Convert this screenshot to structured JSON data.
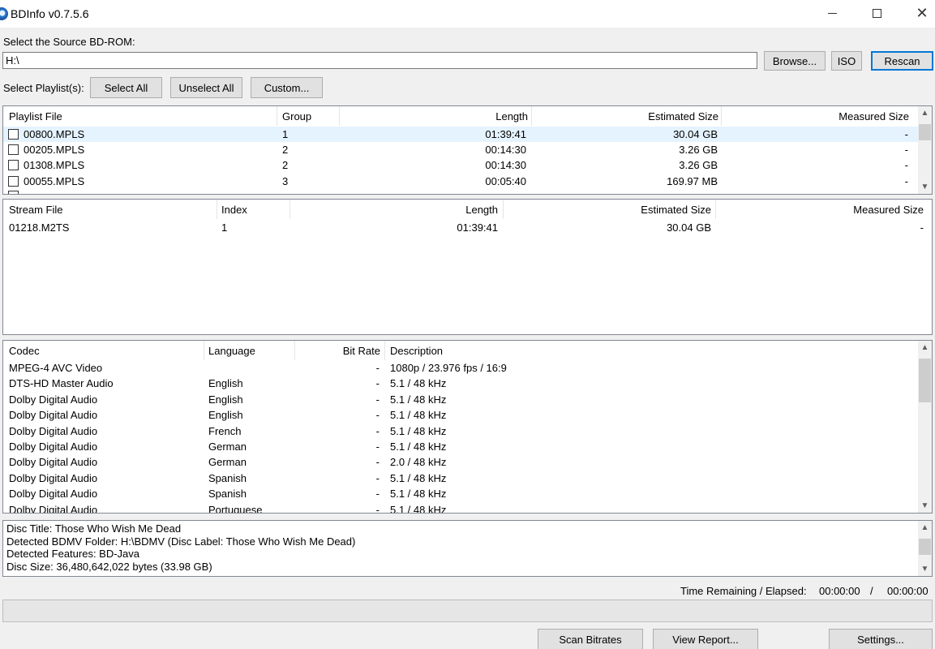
{
  "window": {
    "title": "BDInfo v0.7.5.6"
  },
  "source": {
    "label": "Select the Source BD-ROM:",
    "path": "H:\\",
    "browse_label": "Browse...",
    "iso_label": "ISO",
    "rescan_label": "Rescan"
  },
  "playlist_select": {
    "label": "Select Playlist(s):",
    "select_all": "Select All",
    "unselect_all": "Unselect All",
    "custom": "Custom..."
  },
  "playlists": {
    "columns": [
      "Playlist File",
      "Group",
      "Length",
      "Estimated Size",
      "Measured Size"
    ],
    "rows": [
      {
        "file": "00800.MPLS",
        "group": "1",
        "length": "01:39:41",
        "estimated": "30.04 GB",
        "measured": "-"
      },
      {
        "file": "00205.MPLS",
        "group": "2",
        "length": "00:14:30",
        "estimated": "3.26 GB",
        "measured": "-"
      },
      {
        "file": "01308.MPLS",
        "group": "2",
        "length": "00:14:30",
        "estimated": "3.26 GB",
        "measured": "-"
      },
      {
        "file": "00055.MPLS",
        "group": "3",
        "length": "00:05:40",
        "estimated": "169.97 MB",
        "measured": "-"
      }
    ]
  },
  "streams": {
    "columns": [
      "Stream File",
      "Index",
      "Length",
      "Estimated Size",
      "Measured Size"
    ],
    "rows": [
      {
        "file": "01218.M2TS",
        "index": "1",
        "length": "01:39:41",
        "estimated": "30.04 GB",
        "measured": "-"
      }
    ]
  },
  "codecs": {
    "columns": [
      "Codec",
      "Language",
      "Bit Rate",
      "Description"
    ],
    "rows": [
      {
        "codec": "MPEG-4 AVC Video",
        "language": "",
        "bitrate": "-",
        "description": "1080p / 23.976 fps / 16:9"
      },
      {
        "codec": "DTS-HD Master Audio",
        "language": "English",
        "bitrate": "-",
        "description": "5.1 / 48 kHz"
      },
      {
        "codec": "Dolby Digital Audio",
        "language": "English",
        "bitrate": "-",
        "description": "5.1 / 48 kHz"
      },
      {
        "codec": "Dolby Digital Audio",
        "language": "English",
        "bitrate": "-",
        "description": "5.1 / 48 kHz"
      },
      {
        "codec": "Dolby Digital Audio",
        "language": "French",
        "bitrate": "-",
        "description": "5.1 / 48 kHz"
      },
      {
        "codec": "Dolby Digital Audio",
        "language": "German",
        "bitrate": "-",
        "description": "5.1 / 48 kHz"
      },
      {
        "codec": "Dolby Digital Audio",
        "language": "German",
        "bitrate": "-",
        "description": "2.0 / 48 kHz"
      },
      {
        "codec": "Dolby Digital Audio",
        "language": "Spanish",
        "bitrate": "-",
        "description": "5.1 / 48 kHz"
      },
      {
        "codec": "Dolby Digital Audio",
        "language": "Spanish",
        "bitrate": "-",
        "description": "5.1 / 48 kHz"
      },
      {
        "codec": "Dolby Digital Audio",
        "language": "Portuguese",
        "bitrate": "-",
        "description": "5.1 / 48 kHz"
      }
    ]
  },
  "disc_info": {
    "lines": [
      "Disc Title: Those Who Wish Me Dead",
      "Detected BDMV Folder: H:\\BDMV (Disc Label: Those Who Wish Me Dead)",
      "Detected Features: BD-Java",
      "Disc Size: 36,480,642,022 bytes (33.98 GB)"
    ]
  },
  "status": {
    "time_label": "Time Remaining / Elapsed:",
    "remaining": "00:00:00",
    "separator": "/",
    "elapsed": "00:00:00"
  },
  "footer": {
    "scan_bitrates": "Scan Bitrates",
    "view_report": "View Report...",
    "settings": "Settings..."
  }
}
